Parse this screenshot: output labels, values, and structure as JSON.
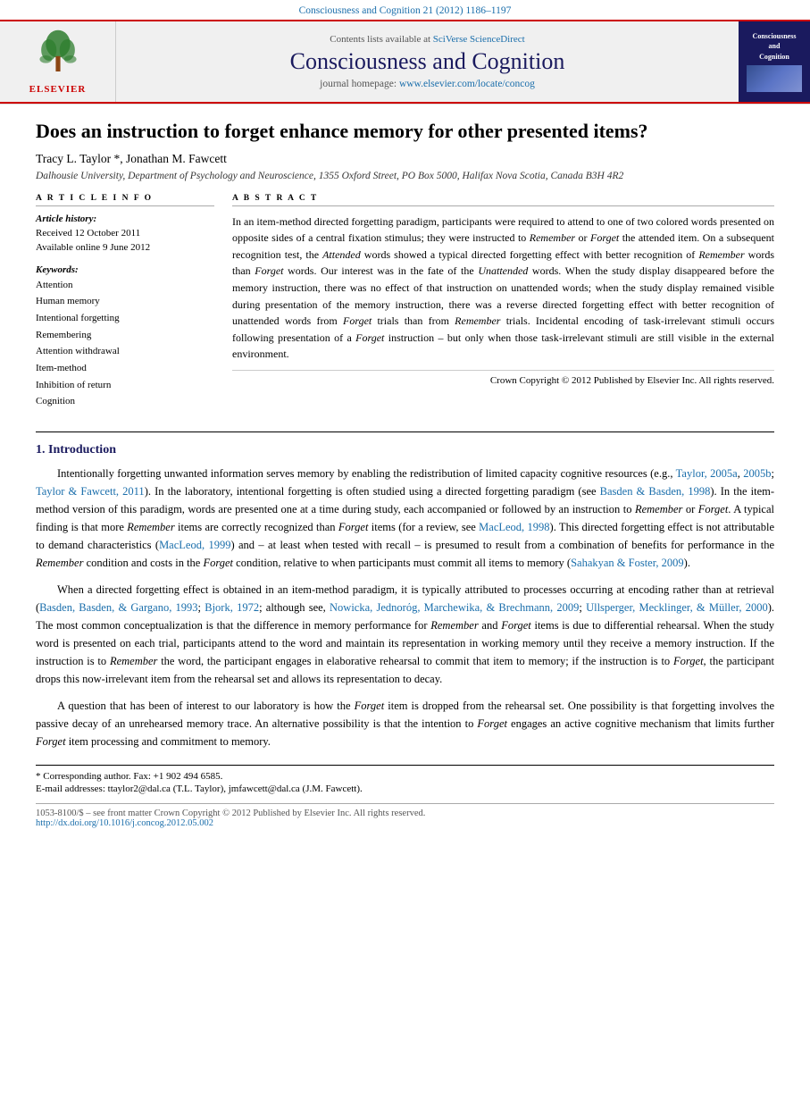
{
  "topBar": {
    "text": "Consciousness and Cognition 21 (2012) 1186–1197"
  },
  "header": {
    "sciverse": "Contents lists available at",
    "sciverseLink": "SciVerse ScienceDirect",
    "journalTitle": "Consciousness and Cognition",
    "homepageLabel": "journal homepage:",
    "homepageUrl": "www.elsevier.com/locate/concog",
    "elsevierText": "ELSEVIER",
    "thumbTitle": "Consciousness and Cognition"
  },
  "article": {
    "title": "Does an instruction to forget enhance memory for other presented items?",
    "authors": "Tracy L. Taylor *, Jonathan M. Fawcett",
    "affiliation": "Dalhousie University, Department of Psychology and Neuroscience, 1355 Oxford Street, PO Box 5000, Halifax Nova Scotia, Canada B3H 4R2"
  },
  "articleInfo": {
    "sectionLabel": "A R T I C L E   I N F O",
    "historyLabel": "Article history:",
    "received": "Received 12 October 2011",
    "available": "Available online 9 June 2012",
    "keywordsLabel": "Keywords:",
    "keywords": [
      "Attention",
      "Human memory",
      "Intentional forgetting",
      "Remembering",
      "Attention withdrawal",
      "Item-method",
      "Inhibition of return",
      "Cognition"
    ]
  },
  "abstract": {
    "sectionLabel": "A B S T R A C T",
    "text": "In an item-method directed forgetting paradigm, participants were required to attend to one of two colored words presented on opposite sides of a central fixation stimulus; they were instructed to Remember or Forget the attended item. On a subsequent recognition test, the Attended words showed a typical directed forgetting effect with better recognition of Remember words than Forget words. Our interest was in the fate of the Unattended words. When the study display disappeared before the memory instruction, there was no effect of that instruction on unattended words; when the study display remained visible during presentation of the memory instruction, there was a reverse directed forgetting effect with better recognition of unattended words from Forget trials than from Remember trials. Incidental encoding of task-irrelevant stimuli occurs following presentation of a Forget instruction – but only when those task-irrelevant stimuli are still visible in the external environment.",
    "copyright": "Crown Copyright © 2012 Published by Elsevier Inc. All rights reserved."
  },
  "introduction": {
    "sectionNumber": "1.",
    "sectionTitle": "Introduction",
    "paragraph1": "Intentionally forgetting unwanted information serves memory by enabling the redistribution of limited capacity cognitive resources (e.g., Taylor, 2005a, 2005b; Taylor & Fawcett, 2011). In the laboratory, intentional forgetting is often studied using a directed forgetting paradigm (see Basden & Basden, 1998). In the item-method version of this paradigm, words are presented one at a time during study, each accompanied or followed by an instruction to Remember or Forget. A typical finding is that more Remember items are correctly recognized than Forget items (for a review, see MacLeod, 1998). This directed forgetting effect is not attributable to demand characteristics (MacLeod, 1999) and – at least when tested with recall – is presumed to result from a combination of benefits for performance in the Remember condition and costs in the Forget condition, relative to when participants must commit all items to memory (Sahakyan & Foster, 2009).",
    "paragraph2": "When a directed forgetting effect is obtained in an item-method paradigm, it is typically attributed to processes occurring at encoding rather than at retrieval (Basden, Basden, & Gargano, 1993; Bjork, 1972; although see, Nowicka, Jednorόg, Marchewika, & Brechmann, 2009; Ullsperger, Mecklinger, & Müller, 2000). The most common conceptualization is that the difference in memory performance for Remember and Forget items is due to differential rehearsal. When the study word is presented on each trial, participants attend to the word and maintain its representation in working memory until they receive a memory instruction. If the instruction is to Remember the word, the participant engages in elaborative rehearsal to commit that item to memory; if the instruction is to Forget, the participant drops this now-irrelevant item from the rehearsal set and allows its representation to decay.",
    "paragraph3": "A question that has been of interest to our laboratory is how the Forget item is dropped from the rehearsal set. One possibility is that forgetting involves the passive decay of an unrehearsed memory trace. An alternative possibility is that the intention to Forget engages an active cognitive mechanism that limits further Forget item processing and commitment to memory."
  },
  "footnotes": {
    "corresponding": "* Corresponding author. Fax: +1 902 494 6585.",
    "email": "E-mail addresses: ttaylor2@dal.ca (T.L. Taylor), jmfawcett@dal.ca (J.M. Fawcett)."
  },
  "footer": {
    "issn": "1053-8100/$ – see front matter Crown Copyright © 2012 Published by Elsevier Inc. All rights reserved.",
    "doi": "http://dx.doi.org/10.1016/j.concog.2012.05.002"
  }
}
